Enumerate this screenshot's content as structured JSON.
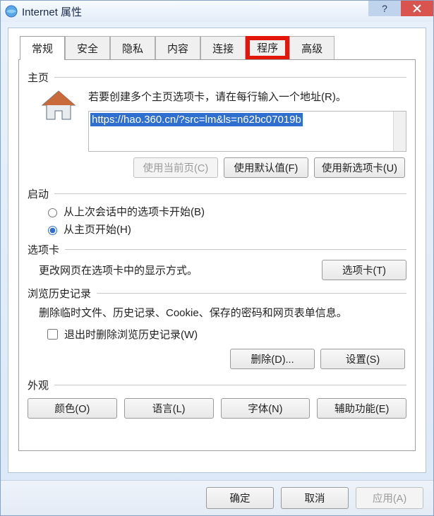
{
  "window": {
    "title": "Internet 属性"
  },
  "tabs": {
    "general": "常规",
    "security": "安全",
    "privacy": "隐私",
    "content": "内容",
    "connections": "连接",
    "programs": "程序",
    "advanced": "高级"
  },
  "home": {
    "heading": "主页",
    "desc": "若要创建多个主页选项卡，请在每行输入一个地址(R)。",
    "url": "https://hao.360.cn/?src=lm&ls=n62bc07019b",
    "use_current": "使用当前页(C)",
    "use_default": "使用默认值(F)",
    "use_new_tab": "使用新选项卡(U)"
  },
  "startup": {
    "heading": "启动",
    "opt_last": "从上次会话中的选项卡开始(B)",
    "opt_home": "从主页开始(H)"
  },
  "tabsec": {
    "heading": "选项卡",
    "desc": "更改网页在选项卡中的显示方式。",
    "button": "选项卡(T)"
  },
  "history": {
    "heading": "浏览历史记录",
    "desc": "删除临时文件、历史记录、Cookie、保存的密码和网页表单信息。",
    "exit_delete": "退出时删除浏览历史记录(W)",
    "delete": "删除(D)...",
    "settings": "设置(S)"
  },
  "appearance": {
    "heading": "外观",
    "colors": "颜色(O)",
    "languages": "语言(L)",
    "fonts": "字体(N)",
    "accessibility": "辅助功能(E)"
  },
  "footer": {
    "ok": "确定",
    "cancel": "取消",
    "apply": "应用(A)"
  }
}
